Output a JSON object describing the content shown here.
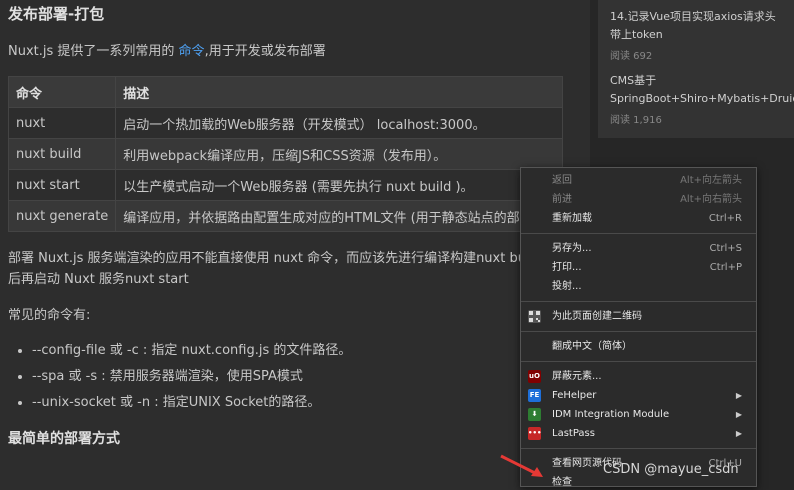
{
  "article": {
    "heading": "发布部署-打包",
    "intro_prefix": "Nuxt.js 提供了一系列常用的 ",
    "intro_link": "命令",
    "intro_suffix": ",用于开发或发布部署",
    "table": {
      "headers": [
        "命令",
        "描述"
      ],
      "rows": [
        [
          "nuxt",
          "启动一个热加载的Web服务器（开发模式） localhost:3000。"
        ],
        [
          "nuxt build",
          "利用webpack编译应用，压缩JS和CSS资源（发布用）。"
        ],
        [
          "nuxt start",
          "以生产模式启动一个Web服务器 (需要先执行 nuxt build )。"
        ],
        [
          "nuxt generate",
          "编译应用，并依据路由配置生成对应的HTML文件 (用于静态站点的部署)。"
        ]
      ]
    },
    "deploy_para_line1": "部署 Nuxt.js 服务端渲染的应用不能直接使用 nuxt 命令，而应该先进行编译构建nuxt build，然",
    "deploy_para_line2": "后再启动 Nuxt 服务nuxt start",
    "common_cmds": "常见的命令有:",
    "options": [
      "--config-file 或 -c : 指定 nuxt.config.js 的文件路径。",
      "--spa 或 -s : 禁用服务器端渲染，使用SPA模式",
      "--unix-socket 或 -n : 指定UNIX Socket的路径。"
    ],
    "subheading": "最简单的部署方式"
  },
  "sidebar": {
    "items": [
      {
        "title": "14.记录Vue项目实现axios请求头带上token",
        "meta": "阅读 692"
      },
      {
        "title": "CMS基于SpringBoot+Shiro+Mybatis+Druid...",
        "meta": "阅读 1,916"
      }
    ]
  },
  "context_menu": {
    "back": "返回",
    "back_sc": "Alt+向左箭头",
    "forward": "前进",
    "forward_sc": "Alt+向右箭头",
    "reload": "重新加载",
    "reload_sc": "Ctrl+R",
    "save_as": "另存为...",
    "save_as_sc": "Ctrl+S",
    "print": "打印...",
    "print_sc": "Ctrl+P",
    "cast": "投射...",
    "qr": "为此页面创建二维码",
    "translate": "翻成中文（简体）",
    "block": "屏蔽元素...",
    "fehelper": "FeHelper",
    "idm": "IDM Integration Module",
    "lastpass": "LastPass",
    "view_source": "查看网页源代码",
    "view_source_sc": "Ctrl+U",
    "inspect": "检查"
  },
  "watermark": "CSDN @mayue_csdn",
  "colors": {
    "link": "#4ea1f3",
    "arrow": "#e53935"
  }
}
